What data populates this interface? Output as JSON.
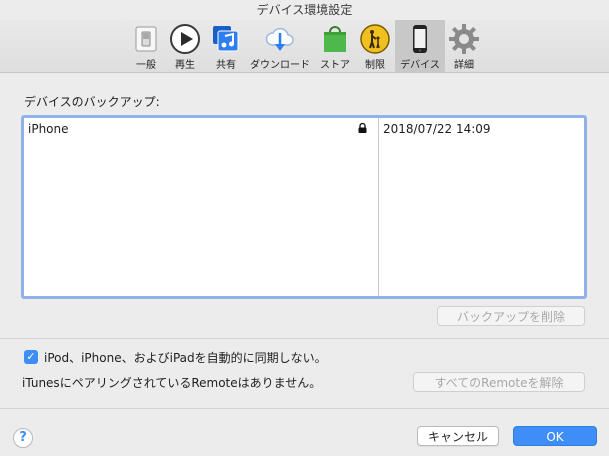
{
  "window": {
    "title": "デバイス環境設定"
  },
  "toolbar": {
    "items": [
      {
        "label": "一般",
        "icon": "general-switch-icon"
      },
      {
        "label": "再生",
        "icon": "play-icon"
      },
      {
        "label": "共有",
        "icon": "sharing-music-icon"
      },
      {
        "label": "ダウンロード",
        "icon": "download-cloud-icon"
      },
      {
        "label": "ストア",
        "icon": "store-bag-icon"
      },
      {
        "label": "制限",
        "icon": "restrictions-parental-icon"
      },
      {
        "label": "デバイス",
        "icon": "device-iphone-icon",
        "selected": true
      },
      {
        "label": "詳細",
        "icon": "gear-icon"
      }
    ]
  },
  "backups": {
    "section_label": "デバイスのバックアップ:",
    "rows": [
      {
        "name": "iPhone",
        "locked": true,
        "date": "2018/07/22 14:09"
      }
    ],
    "delete_button": "バックアップを削除"
  },
  "sync": {
    "checkbox_checked": true,
    "checkbox_label": "iPod、iPhone、およびiPadを自動的に同期しない。"
  },
  "remote": {
    "status_text": "iTunesにペアリングされているRemoteはありません。",
    "unpair_button": "すべてのRemoteを解除"
  },
  "footer": {
    "help_label": "?",
    "cancel_button": "キャンセル",
    "ok_button": "OK"
  },
  "colors": {
    "accent": "#3f8ef7",
    "selection_border": "#8fb3e8",
    "store_green": "#4fb84a",
    "restrict_yellow": "#f0c020"
  }
}
